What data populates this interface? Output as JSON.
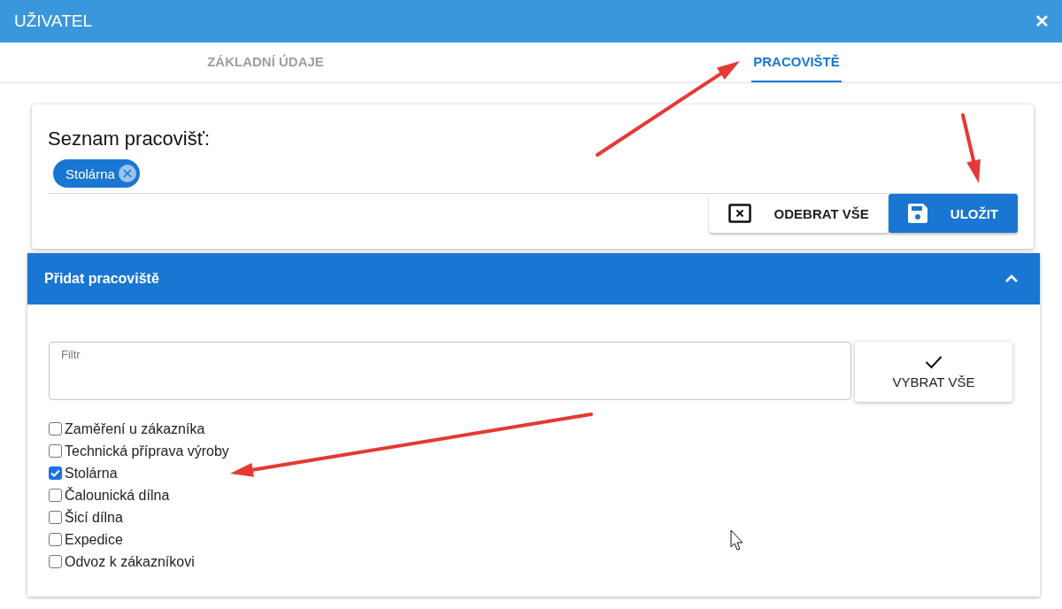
{
  "window": {
    "title": "UŽIVATEL",
    "close": "✕"
  },
  "tabs": [
    {
      "label": "ZÁKLADNÍ ÚDAJE",
      "selected": false
    },
    {
      "label": "PRACOVIŠTĚ",
      "selected": true
    }
  ],
  "list_card": {
    "title": "Seznam pracovišť:",
    "chips": [
      "Stolárna"
    ],
    "buttons": [
      {
        "kind": "remove",
        "label": "ODEBRAT VŠE"
      },
      {
        "kind": "save",
        "label": "ULOŽIT"
      }
    ]
  },
  "add_panel": {
    "title": "Přidat pracoviště",
    "expanded": true,
    "filter": {
      "placeholder": "Filtr"
    },
    "select_all": "VYBRAT VŠE",
    "items": [
      {
        "label": "Zaměření u zákazníka",
        "checked": false
      },
      {
        "label": "Technická příprava výroby",
        "checked": false
      },
      {
        "label": "Stolárna",
        "checked": true
      },
      {
        "label": "Čalounická dílna",
        "checked": false
      },
      {
        "label": "Šicí dílna",
        "checked": false
      },
      {
        "label": "Expedice",
        "checked": false
      },
      {
        "label": "Odvoz k zákazníkovi",
        "checked": false
      }
    ]
  }
}
